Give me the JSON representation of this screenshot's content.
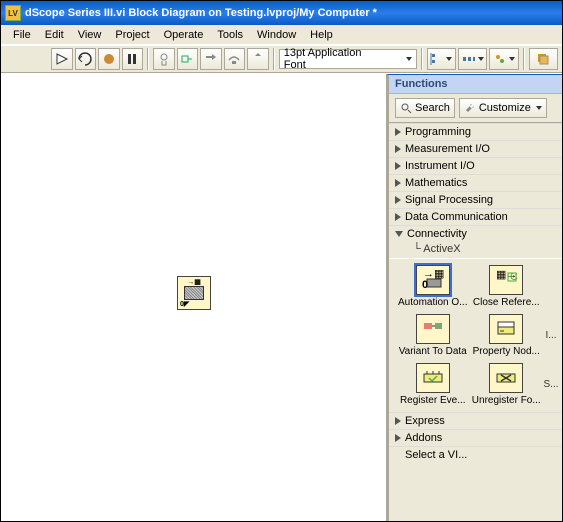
{
  "title": "dScope Series III.vi Block Diagram on Testing.lvproj/My Computer *",
  "menu": {
    "file": "File",
    "edit": "Edit",
    "view": "View",
    "project": "Project",
    "operate": "Operate",
    "tools": "Tools",
    "window": "Window",
    "help": "Help"
  },
  "toolbar": {
    "font_label": "13pt Application Font"
  },
  "palette": {
    "title": "Functions",
    "search_label": "Search",
    "customize_label": "Customize",
    "categories": [
      {
        "label": "Programming",
        "open": false
      },
      {
        "label": "Measurement I/O",
        "open": false
      },
      {
        "label": "Instrument I/O",
        "open": false
      },
      {
        "label": "Mathematics",
        "open": false
      },
      {
        "label": "Signal Processing",
        "open": false
      },
      {
        "label": "Data Communication",
        "open": false
      },
      {
        "label": "Connectivity",
        "open": true,
        "child": "ActiveX"
      },
      {
        "label": "Express",
        "open": false
      },
      {
        "label": "Addons",
        "open": false
      },
      {
        "label": "Select a VI...",
        "open": false
      }
    ],
    "activex_items": [
      {
        "label": "Automation O...",
        "selected": true
      },
      {
        "label": "Close Refere..."
      },
      {
        "label": "Variant To Data"
      },
      {
        "label": "Property Nod..."
      },
      {
        "label": "I..."
      },
      {
        "label": "Register Eve..."
      },
      {
        "label": "Unregister Fo..."
      },
      {
        "label": "S..."
      }
    ]
  },
  "canvas_node": {
    "name": "automation-open-node"
  }
}
